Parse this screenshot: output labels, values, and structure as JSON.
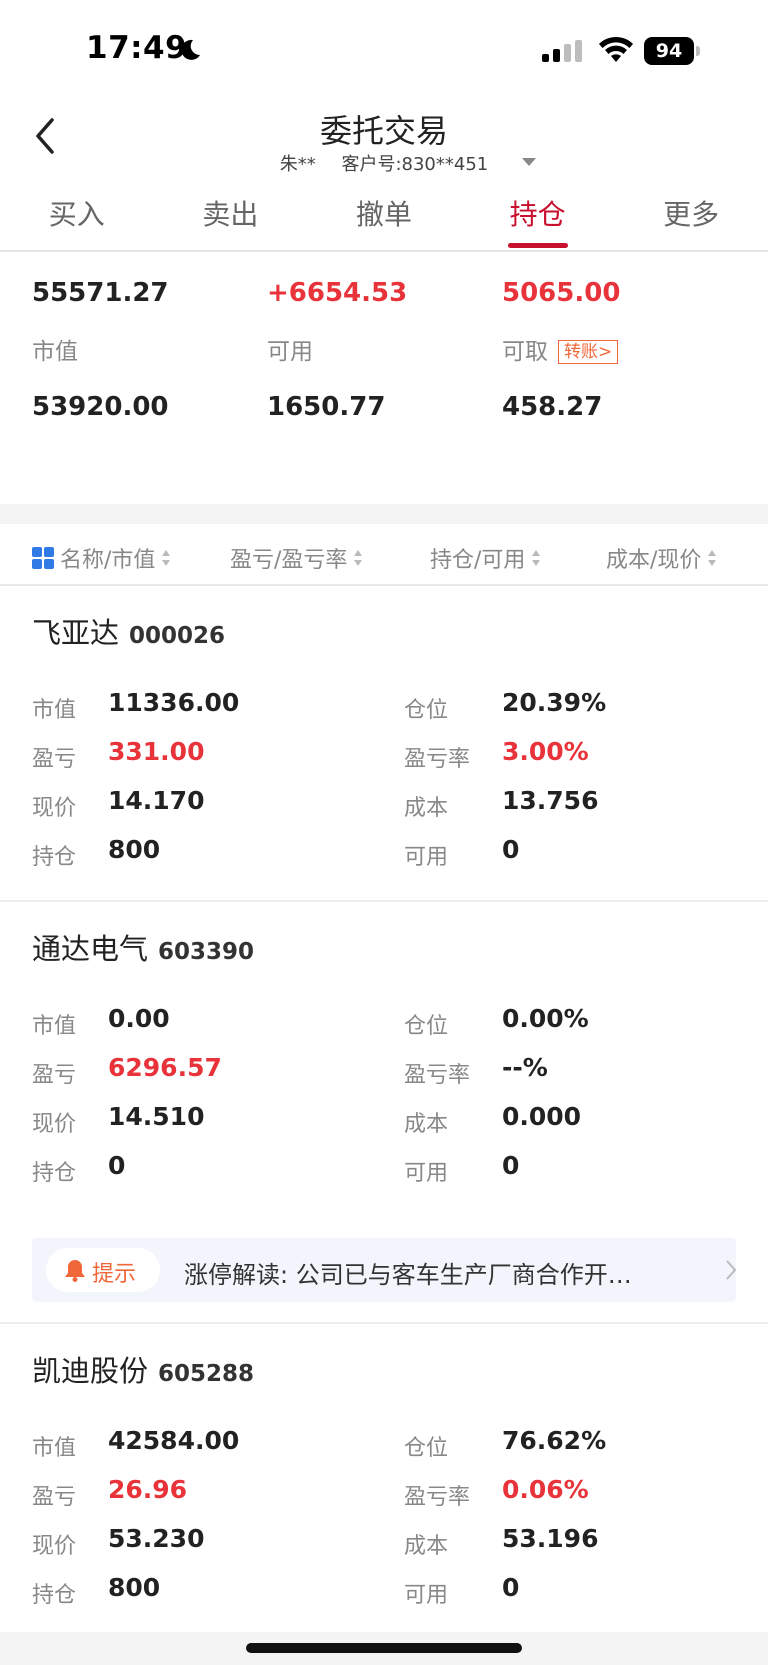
{
  "status_bar": {
    "time": "17:49",
    "battery": "94"
  },
  "header": {
    "title": "委托交易",
    "user_name": "朱**",
    "account": "客户号:830**451"
  },
  "tabs": [
    {
      "label": "买入"
    },
    {
      "label": "卖出"
    },
    {
      "label": "撤单"
    },
    {
      "label": "持仓",
      "active": true
    },
    {
      "label": "更多"
    }
  ],
  "summary": {
    "total_asset_value": "55571.27",
    "profit_value": "+6654.53",
    "today_profit_value": "5065.00",
    "market_value_label": "市值",
    "market_value": "53920.00",
    "available_label": "可用",
    "available": "1650.77",
    "withdrawable_label": "可取",
    "withdrawable": "458.27",
    "transfer_label": "转账>"
  },
  "columns": [
    {
      "label": "名称/市值"
    },
    {
      "label": "盈亏/盈亏率"
    },
    {
      "label": "持仓/可用"
    },
    {
      "label": "成本/现价"
    }
  ],
  "holdings": [
    {
      "name": "飞亚达",
      "code": "000026",
      "market_value_label": "市值",
      "market_value": "11336.00",
      "position_label": "仓位",
      "position": "20.39%",
      "pnl_label": "盈亏",
      "pnl": "331.00",
      "pnl_rate_label": "盈亏率",
      "pnl_rate": "3.00%",
      "price_label": "现价",
      "price": "14.170",
      "cost_label": "成本",
      "cost": "13.756",
      "holding_label": "持仓",
      "holding": "800",
      "available_label": "可用",
      "available": "0"
    },
    {
      "name": "通达电气",
      "code": "603390",
      "market_value_label": "市值",
      "market_value": "0.00",
      "position_label": "仓位",
      "position": "0.00%",
      "pnl_label": "盈亏",
      "pnl": "6296.57",
      "pnl_rate_label": "盈亏率",
      "pnl_rate": "--%",
      "price_label": "现价",
      "price": "14.510",
      "cost_label": "成本",
      "cost": "0.000",
      "holding_label": "持仓",
      "holding": "0",
      "available_label": "可用",
      "available": "0"
    },
    {
      "name": "凯迪股份",
      "code": "605288",
      "market_value_label": "市值",
      "market_value": "42584.00",
      "position_label": "仓位",
      "position": "76.62%",
      "pnl_label": "盈亏",
      "pnl": "26.96",
      "pnl_rate_label": "盈亏率",
      "pnl_rate": "0.06%",
      "price_label": "现价",
      "price": "53.230",
      "cost_label": "成本",
      "cost": "53.196",
      "holding_label": "持仓",
      "holding": "800",
      "available_label": "可用",
      "available": "0"
    }
  ],
  "tip": {
    "label": "提示",
    "text": "涨停解读: 公司已与客车生产厂商合作开…"
  },
  "colors": {
    "accent": "#c8102e",
    "up": "#e8333a",
    "tag": "#f0683a"
  }
}
